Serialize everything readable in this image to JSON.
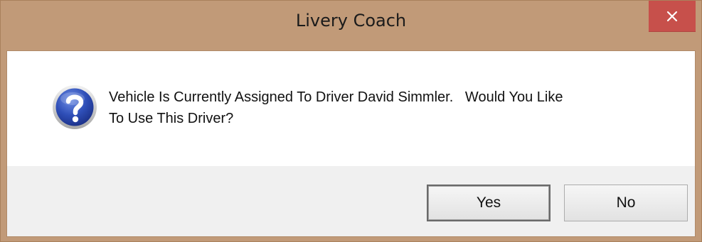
{
  "window": {
    "title": "Livery Coach",
    "frame_color": "#c19a78",
    "close_button_color": "#c7504b"
  },
  "dialog": {
    "icon": "question-icon",
    "message_line1": "Vehicle Is Currently Assigned To Driver David Simmler.   Would You Like",
    "message_line2": "To Use This Driver?"
  },
  "buttons": {
    "yes_label": "Yes",
    "no_label": "No"
  }
}
